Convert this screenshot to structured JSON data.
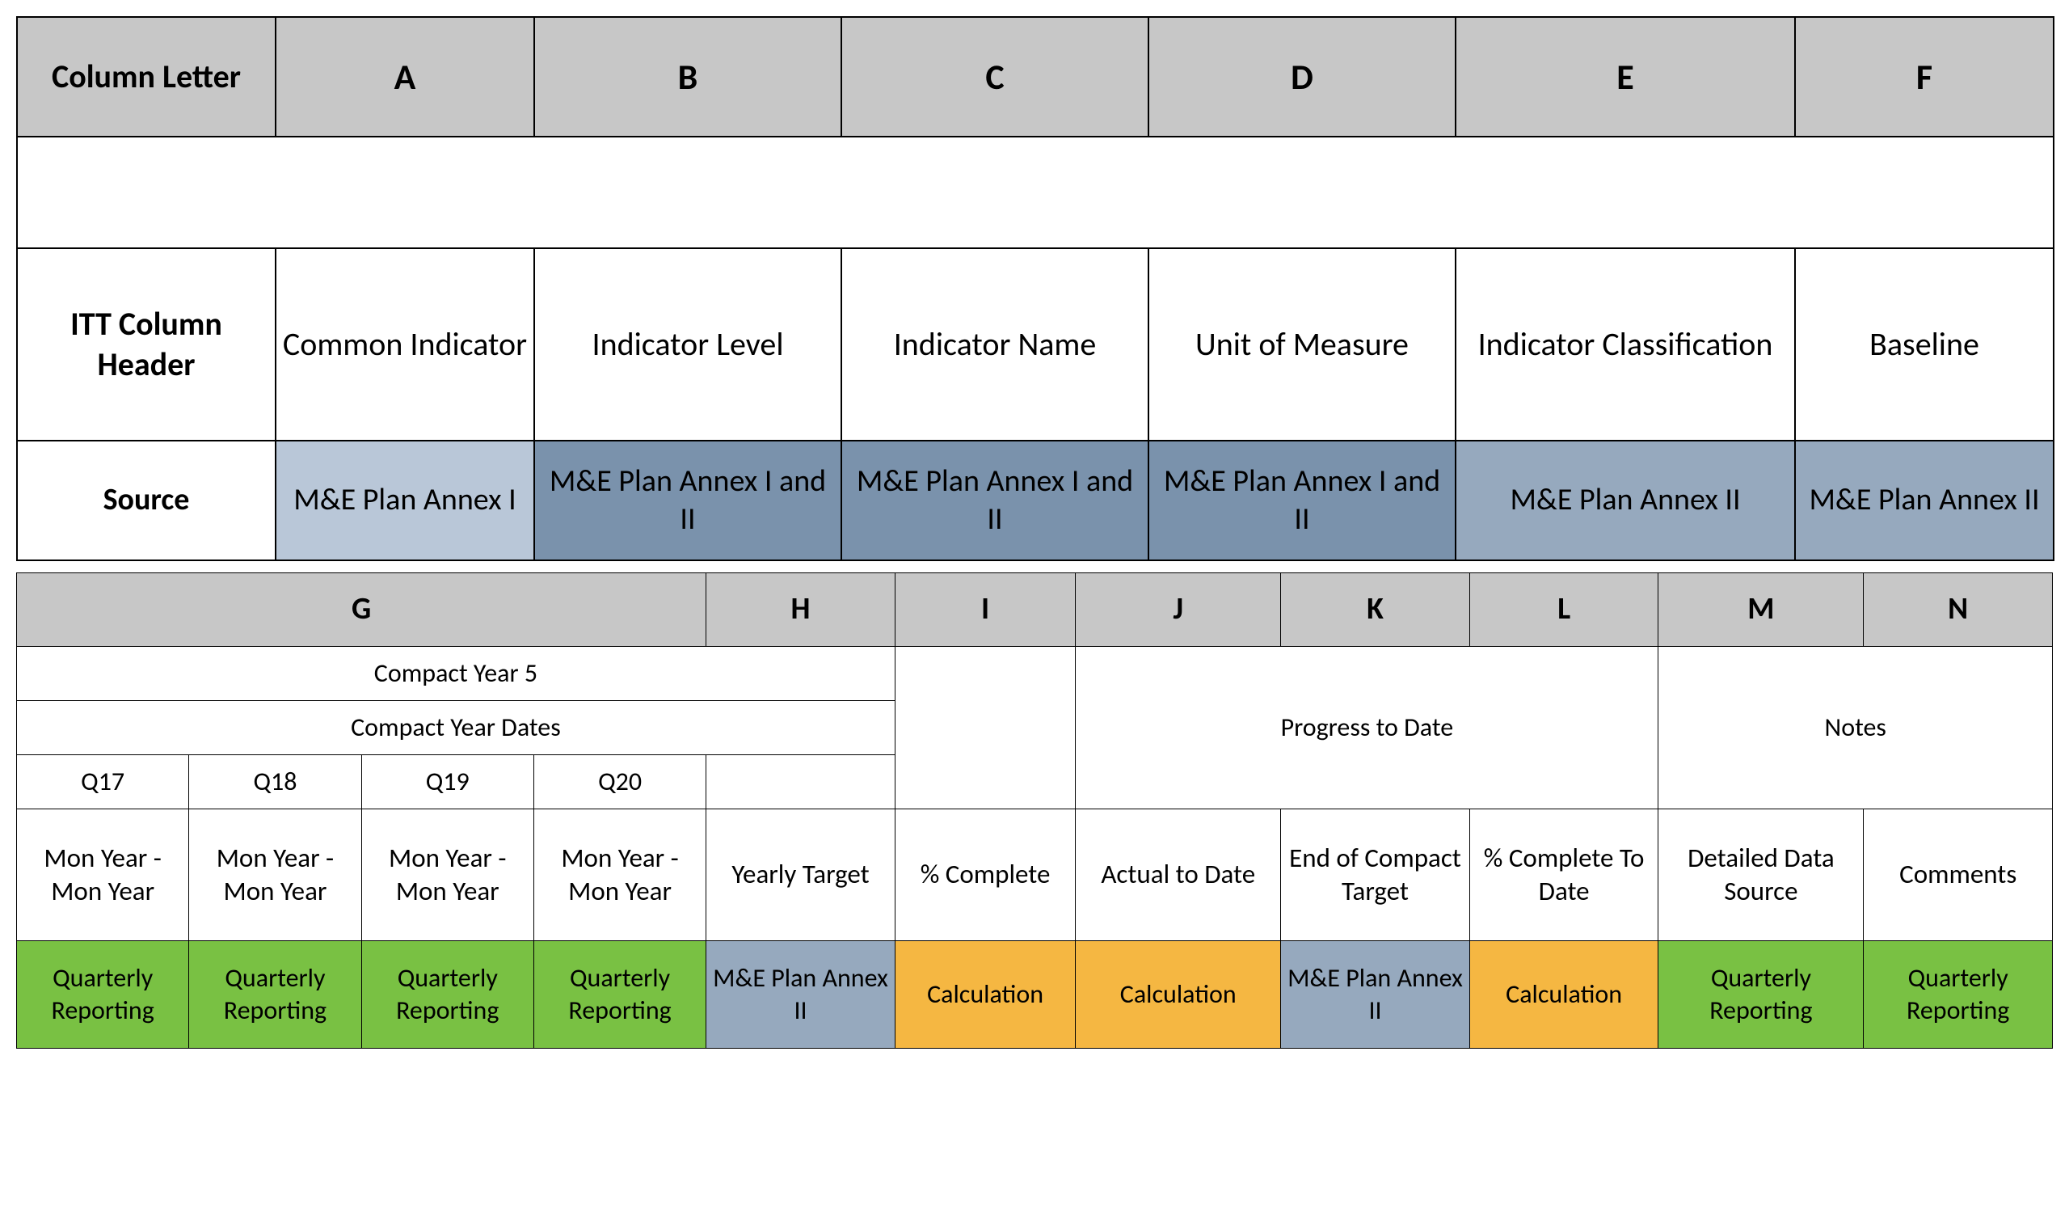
{
  "top": {
    "rowlabels": [
      "Column Letter",
      "ITT Column Header",
      "Source"
    ],
    "letters": [
      "A",
      "B",
      "C",
      "D",
      "E",
      "F"
    ],
    "headers": [
      "Common Indicator",
      "Indicator Level",
      "Indicator Name",
      "Unit of Measure",
      "Indicator Classification",
      "Baseline"
    ],
    "sources": [
      "M&E Plan Annex I",
      "M&E Plan Annex I and II",
      "M&E Plan Annex I and II",
      "M&E Plan Annex I and II",
      "M&E Plan Annex II",
      "M&E Plan Annex II"
    ]
  },
  "bottom": {
    "letters": [
      "G",
      "H",
      "I",
      "J",
      "K",
      "L",
      "M",
      "N"
    ],
    "group_g_title": "Compact Year 5",
    "group_g_dates": "Compact Year Dates",
    "quarters": [
      "Q17",
      "Q18",
      "Q19",
      "Q20"
    ],
    "progress_title": "Progress to Date",
    "notes_title": "Notes",
    "row_names": {
      "g1": "Mon Year - Mon Year",
      "g2": "Mon Year - Mon Year",
      "g3": "Mon Year - Mon Year",
      "g4": "Mon Year - Mon Year",
      "h": "Yearly Target",
      "i": "% Complete",
      "j": "Actual to Date",
      "k": "End of Compact Target",
      "l": "% Complete To Date",
      "m": "Detailed Data Source",
      "n": "Comments"
    },
    "sources": {
      "g": "Quarterly Reporting",
      "h": "M&E Plan Annex II",
      "i": "Calculation",
      "j": "Calculation",
      "k": "M&E Plan Annex II",
      "l": "Calculation",
      "m": "Quarterly Reporting",
      "n": "Quarterly Reporting"
    }
  }
}
